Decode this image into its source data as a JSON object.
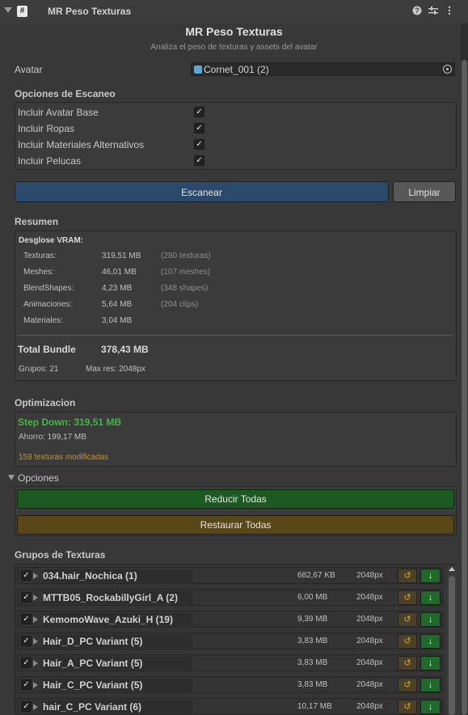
{
  "window": {
    "tab_title": "MR Peso Texturas",
    "tab_icon_glyph": "#",
    "help_glyph": "?",
    "settings_glyph": "⇄",
    "menu_glyph": "⋮"
  },
  "header": {
    "title": "MR Peso Texturas",
    "subtitle": "Analiza el peso de texturas y assets del avatar"
  },
  "avatar": {
    "label": "Avatar",
    "value": "Cornet_001 (2)"
  },
  "scan_options": {
    "heading": "Opciones de Escaneo",
    "items": [
      {
        "label": "Incluir Avatar Base",
        "checked": true
      },
      {
        "label": "Incluir Ropas",
        "checked": true
      },
      {
        "label": "Incluir Materiales Alternativos",
        "checked": true
      },
      {
        "label": "Incluir Pelucas",
        "checked": true
      }
    ],
    "check_glyph": "✓"
  },
  "actions": {
    "scan_label": "Escanear",
    "clear_label": "Limpiar"
  },
  "summary": {
    "heading": "Resumen",
    "vram_heading": "Desglose VRAM:",
    "rows": [
      {
        "label": "Texturas:",
        "value": "319,51 MB",
        "detail": "(280 texturas)"
      },
      {
        "label": "Meshes:",
        "value": "46,01 MB",
        "detail": "(107 meshes)"
      },
      {
        "label": "BlendShapes:",
        "value": "4,23 MB",
        "detail": "(348 shapes)"
      },
      {
        "label": "Animaciones:",
        "value": "5,64 MB",
        "detail": "(204 clips)"
      },
      {
        "label": "Materiales:",
        "value": "3,04 MB",
        "detail": ""
      }
    ],
    "total_label": "Total Bundle",
    "total_value": "378,43 MB",
    "groups_text": "Grupos: 21",
    "max_res_text": "Max res: 2048px"
  },
  "optimization": {
    "heading": "Optimizacion",
    "step_down": "Step Down: 319,51 MB",
    "savings": "Ahorro: 199,17 MB",
    "modified": "159 texturas modificadas",
    "options_label": "Opciones",
    "reduce_all_label": "Reducir Todas",
    "restore_all_label": "Restaurar Todas"
  },
  "texture_groups": {
    "heading": "Grupos de Texturas",
    "restore_glyph": "↺",
    "down_glyph": "↓",
    "rows": [
      {
        "name": "034.hair_Nochica (1)",
        "size": "682,67 KB",
        "res": "2048px"
      },
      {
        "name": "MTTB05_RockabillyGirl_A (2)",
        "size": "6,00 MB",
        "res": "2048px"
      },
      {
        "name": "KemomoWave_Azuki_H (19)",
        "size": "9,39 MB",
        "res": "2048px"
      },
      {
        "name": "Hair_D_PC Variant (5)",
        "size": "3,83 MB",
        "res": "2048px"
      },
      {
        "name": "Hair_A_PC Variant (5)",
        "size": "3,83 MB",
        "res": "2048px"
      },
      {
        "name": "Hair_C_PC Variant (5)",
        "size": "3,83 MB",
        "res": "2048px"
      },
      {
        "name": "hair_C_PC Variant (6)",
        "size": "10,17 MB",
        "res": "2048px"
      }
    ]
  },
  "colors": {
    "scan_button": "#2b4a6b",
    "clear_button": "#585858",
    "reduce_all": "#1c5a22",
    "restore_all": "#5a4718",
    "step_down_text": "#44b544",
    "modified_text": "#c7922f"
  }
}
